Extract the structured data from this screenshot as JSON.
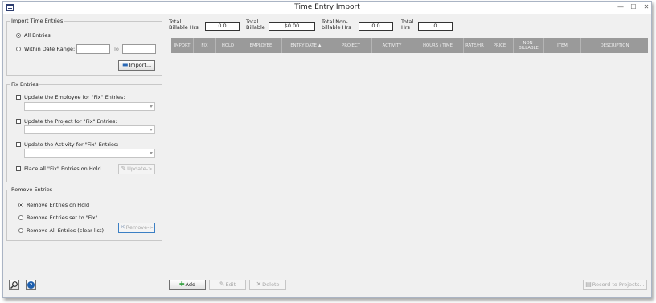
{
  "window": {
    "title": "Time Entry Import",
    "controls": [
      "—",
      "☐",
      "✕"
    ]
  },
  "import_group": {
    "title": "Import Time Entries",
    "all_entries": "All Entries",
    "within_date_range": "Within Date Range:",
    "to_label": "To",
    "date_from": "",
    "date_to": "",
    "import_button": "Import...",
    "selected": "all_entries"
  },
  "fix_group": {
    "title": "Fix Entries",
    "employee_label": "Update the Employee for \"Fix\" Entries:",
    "project_label": "Update the Project for \"Fix\" Entries:",
    "activity_label": "Update the Activity for \"Fix\" Entries:",
    "hold_label": "Place all \"Fix\" Entries on Hold",
    "update_button": "Update->"
  },
  "remove_group": {
    "title": "Remove Entries",
    "on_hold": "Remove Entries on Hold",
    "set_to_fix": "Remove Entries set to \"Fix\"",
    "all_entries": "Remove All Entries (clear list)",
    "remove_button": "Remove->",
    "selected": "on_hold"
  },
  "totals": {
    "billable_label": "Total\nBillable Hrs",
    "billable_value": "0.0",
    "billable_amount_label": "Total\nBillable",
    "billable_amount_value": "$0.00",
    "nonbillable_label": "Total Non-\nbillable Hrs",
    "nonbillable_value": "0.0",
    "total_hrs_label": "Total\nHrs",
    "total_hrs_value": "0"
  },
  "grid": {
    "columns": [
      "IMPORT",
      "FIX",
      "HOLD",
      "EMPLOYEE",
      "ENTRY DATE ▲",
      "PROJECT",
      "ACTIVITY",
      "HOURS / TIME",
      "RATE/HR",
      "PRICE",
      "NON-\nBILLABLE",
      "ITEM",
      "DESCRIPTION"
    ],
    "rows": []
  },
  "footer": {
    "add_button": "Add",
    "edit_button": "Edit",
    "delete_button": "Delete",
    "record_button": "Record to Projects..."
  },
  "colors": {
    "grid_header": "#9a9a9a",
    "accent": "#3b7fc4",
    "add_icon": "#2e9e3a"
  },
  "icons": {
    "search": "search-icon",
    "help": "help-icon",
    "import": "folder-icon",
    "add": "plus-icon",
    "edit": "pencil-icon",
    "delete": "x-icon",
    "remove": "x-icon",
    "record": "record-icon"
  }
}
